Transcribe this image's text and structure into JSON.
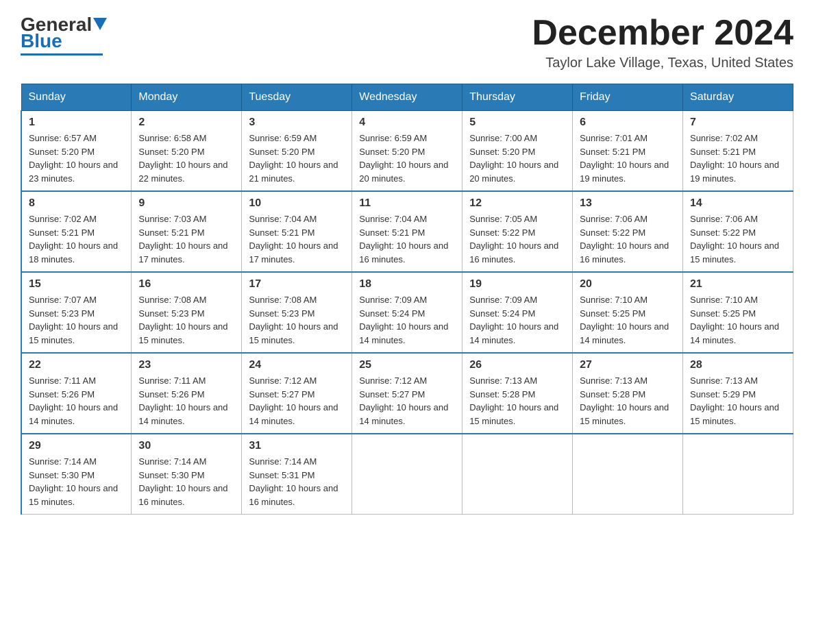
{
  "logo": {
    "general": "General",
    "blue": "Blue"
  },
  "title": {
    "month": "December 2024",
    "location": "Taylor Lake Village, Texas, United States"
  },
  "headers": [
    "Sunday",
    "Monday",
    "Tuesday",
    "Wednesday",
    "Thursday",
    "Friday",
    "Saturday"
  ],
  "weeks": [
    [
      {
        "day": "1",
        "sunrise": "6:57 AM",
        "sunset": "5:20 PM",
        "daylight": "10 hours and 23 minutes."
      },
      {
        "day": "2",
        "sunrise": "6:58 AM",
        "sunset": "5:20 PM",
        "daylight": "10 hours and 22 minutes."
      },
      {
        "day": "3",
        "sunrise": "6:59 AM",
        "sunset": "5:20 PM",
        "daylight": "10 hours and 21 minutes."
      },
      {
        "day": "4",
        "sunrise": "6:59 AM",
        "sunset": "5:20 PM",
        "daylight": "10 hours and 20 minutes."
      },
      {
        "day": "5",
        "sunrise": "7:00 AM",
        "sunset": "5:20 PM",
        "daylight": "10 hours and 20 minutes."
      },
      {
        "day": "6",
        "sunrise": "7:01 AM",
        "sunset": "5:21 PM",
        "daylight": "10 hours and 19 minutes."
      },
      {
        "day": "7",
        "sunrise": "7:02 AM",
        "sunset": "5:21 PM",
        "daylight": "10 hours and 19 minutes."
      }
    ],
    [
      {
        "day": "8",
        "sunrise": "7:02 AM",
        "sunset": "5:21 PM",
        "daylight": "10 hours and 18 minutes."
      },
      {
        "day": "9",
        "sunrise": "7:03 AM",
        "sunset": "5:21 PM",
        "daylight": "10 hours and 17 minutes."
      },
      {
        "day": "10",
        "sunrise": "7:04 AM",
        "sunset": "5:21 PM",
        "daylight": "10 hours and 17 minutes."
      },
      {
        "day": "11",
        "sunrise": "7:04 AM",
        "sunset": "5:21 PM",
        "daylight": "10 hours and 16 minutes."
      },
      {
        "day": "12",
        "sunrise": "7:05 AM",
        "sunset": "5:22 PM",
        "daylight": "10 hours and 16 minutes."
      },
      {
        "day": "13",
        "sunrise": "7:06 AM",
        "sunset": "5:22 PM",
        "daylight": "10 hours and 16 minutes."
      },
      {
        "day": "14",
        "sunrise": "7:06 AM",
        "sunset": "5:22 PM",
        "daylight": "10 hours and 15 minutes."
      }
    ],
    [
      {
        "day": "15",
        "sunrise": "7:07 AM",
        "sunset": "5:23 PM",
        "daylight": "10 hours and 15 minutes."
      },
      {
        "day": "16",
        "sunrise": "7:08 AM",
        "sunset": "5:23 PM",
        "daylight": "10 hours and 15 minutes."
      },
      {
        "day": "17",
        "sunrise": "7:08 AM",
        "sunset": "5:23 PM",
        "daylight": "10 hours and 15 minutes."
      },
      {
        "day": "18",
        "sunrise": "7:09 AM",
        "sunset": "5:24 PM",
        "daylight": "10 hours and 14 minutes."
      },
      {
        "day": "19",
        "sunrise": "7:09 AM",
        "sunset": "5:24 PM",
        "daylight": "10 hours and 14 minutes."
      },
      {
        "day": "20",
        "sunrise": "7:10 AM",
        "sunset": "5:25 PM",
        "daylight": "10 hours and 14 minutes."
      },
      {
        "day": "21",
        "sunrise": "7:10 AM",
        "sunset": "5:25 PM",
        "daylight": "10 hours and 14 minutes."
      }
    ],
    [
      {
        "day": "22",
        "sunrise": "7:11 AM",
        "sunset": "5:26 PM",
        "daylight": "10 hours and 14 minutes."
      },
      {
        "day": "23",
        "sunrise": "7:11 AM",
        "sunset": "5:26 PM",
        "daylight": "10 hours and 14 minutes."
      },
      {
        "day": "24",
        "sunrise": "7:12 AM",
        "sunset": "5:27 PM",
        "daylight": "10 hours and 14 minutes."
      },
      {
        "day": "25",
        "sunrise": "7:12 AM",
        "sunset": "5:27 PM",
        "daylight": "10 hours and 14 minutes."
      },
      {
        "day": "26",
        "sunrise": "7:13 AM",
        "sunset": "5:28 PM",
        "daylight": "10 hours and 15 minutes."
      },
      {
        "day": "27",
        "sunrise": "7:13 AM",
        "sunset": "5:28 PM",
        "daylight": "10 hours and 15 minutes."
      },
      {
        "day": "28",
        "sunrise": "7:13 AM",
        "sunset": "5:29 PM",
        "daylight": "10 hours and 15 minutes."
      }
    ],
    [
      {
        "day": "29",
        "sunrise": "7:14 AM",
        "sunset": "5:30 PM",
        "daylight": "10 hours and 15 minutes."
      },
      {
        "day": "30",
        "sunrise": "7:14 AM",
        "sunset": "5:30 PM",
        "daylight": "10 hours and 16 minutes."
      },
      {
        "day": "31",
        "sunrise": "7:14 AM",
        "sunset": "5:31 PM",
        "daylight": "10 hours and 16 minutes."
      },
      null,
      null,
      null,
      null
    ]
  ]
}
